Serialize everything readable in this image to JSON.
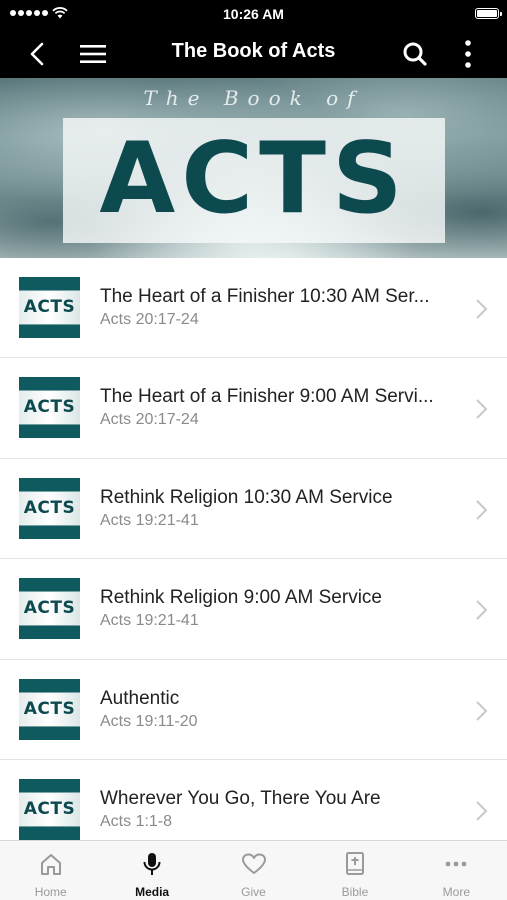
{
  "status_bar": {
    "time": "10:26 AM"
  },
  "nav": {
    "title": "The Book of Acts"
  },
  "banner": {
    "script_text": "The Book of",
    "title_text": "ACTS"
  },
  "items": [
    {
      "title": "The Heart of a Finisher 10:30 AM Ser...",
      "subtitle": "Acts 20:17-24",
      "thumb_text": "ACTS"
    },
    {
      "title": "The Heart of a Finisher 9:00 AM Servi...",
      "subtitle": "Acts 20:17-24",
      "thumb_text": "ACTS"
    },
    {
      "title": "Rethink Religion 10:30 AM Service",
      "subtitle": "Acts 19:21-41",
      "thumb_text": "ACTS"
    },
    {
      "title": "Rethink Religion 9:00 AM Service",
      "subtitle": "Acts 19:21-41",
      "thumb_text": "ACTS"
    },
    {
      "title": "Authentic",
      "subtitle": "Acts 19:11-20",
      "thumb_text": "ACTS"
    },
    {
      "title": "Wherever You Go, There You Are",
      "subtitle": "Acts 1:1-8",
      "thumb_text": "ACTS"
    }
  ],
  "tabs": [
    {
      "label": "Home",
      "icon": "home-icon",
      "active": false
    },
    {
      "label": "Media",
      "icon": "microphone-icon",
      "active": true
    },
    {
      "label": "Give",
      "icon": "heart-icon",
      "active": false
    },
    {
      "label": "Bible",
      "icon": "bible-icon",
      "active": false
    },
    {
      "label": "More",
      "icon": "more-dots-icon",
      "active": false
    }
  ],
  "colors": {
    "nav_bg": "#000000",
    "accent_teal": "#0f5a5e",
    "subtitle_gray": "#8a8a8a",
    "tab_inactive": "#9a9a9a"
  }
}
